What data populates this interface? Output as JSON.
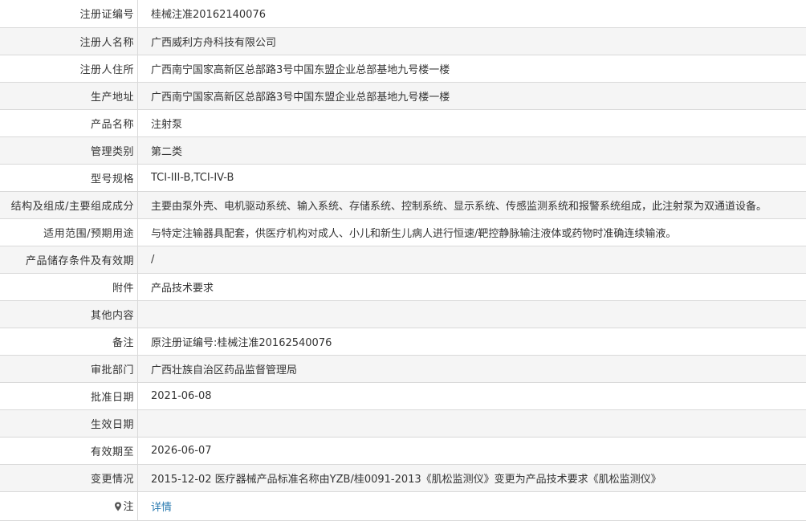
{
  "rows": [
    {
      "label": "注册证编号",
      "value": "桂械注准20162140076"
    },
    {
      "label": "注册人名称",
      "value": "广西威利方舟科技有限公司"
    },
    {
      "label": "注册人住所",
      "value": "广西南宁国家高新区总部路3号中国东盟企业总部基地九号楼一楼"
    },
    {
      "label": "生产地址",
      "value": "广西南宁国家高新区总部路3号中国东盟企业总部基地九号楼一楼"
    },
    {
      "label": "产品名称",
      "value": "注射泵"
    },
    {
      "label": "管理类别",
      "value": "第二类"
    },
    {
      "label": "型号规格",
      "value": "TCI-III-B,TCI-IV-B"
    },
    {
      "label": "结构及组成/主要组成成分",
      "value": "主要由泵外壳、电机驱动系统、输入系统、存储系统、控制系统、显示系统、传感监测系统和报警系统组成，此注射泵为双通道设备。"
    },
    {
      "label": "适用范围/预期用途",
      "value": "与特定注输器具配套，供医疗机构对成人、小儿和新生儿病人进行恒速/靶控静脉输注液体或药物时准确连续输液。"
    },
    {
      "label": "产品储存条件及有效期",
      "value": "/"
    },
    {
      "label": "附件",
      "value": "产品技术要求"
    },
    {
      "label": "其他内容",
      "value": ""
    },
    {
      "label": "备注",
      "value": "原注册证编号:桂械注准20162540076"
    },
    {
      "label": "审批部门",
      "value": "广西壮族自治区药品监督管理局"
    },
    {
      "label": "批准日期",
      "value": "2021-06-08"
    },
    {
      "label": "生效日期",
      "value": ""
    },
    {
      "label": "有效期至",
      "value": "2026-06-07"
    },
    {
      "label": "变更情况",
      "value": "2015-12-02 医疗器械产品标准名称由YZB/桂0091-2013《肌松监测仪》变更为产品技术要求《肌松监测仪》"
    }
  ],
  "note_row": {
    "label": "注",
    "icon": "map-pin-icon",
    "link_text": "详情",
    "link_color": "#2a7ab0"
  }
}
